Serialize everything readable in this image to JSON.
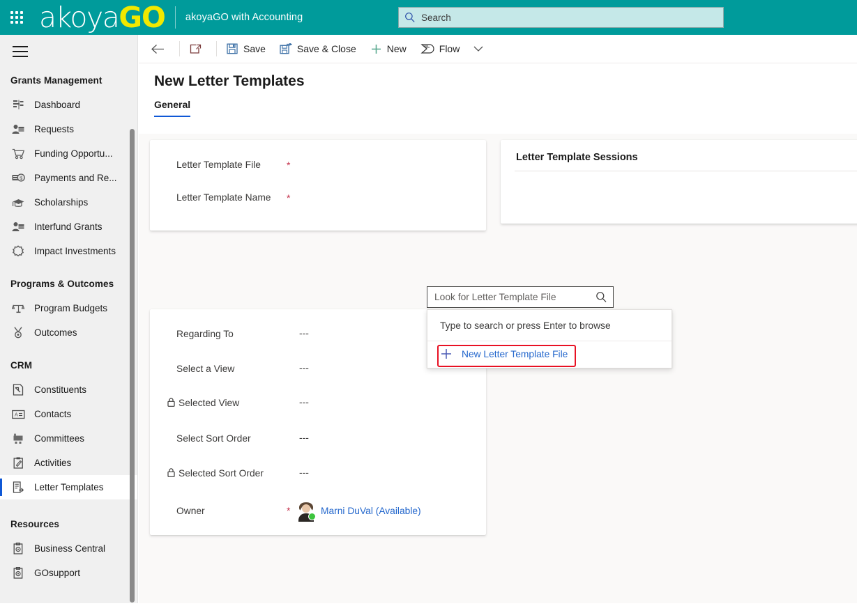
{
  "header": {
    "waffle_icon": "app-launcher-icon",
    "brand_primary": "akoya",
    "brand_accent": "GO",
    "app_title": "akoyaGO with Accounting",
    "search_placeholder": "Search",
    "search_icon": "search-icon",
    "background_color": "#009b9b",
    "accent_color": "#f2e800"
  },
  "sidebar": {
    "menu_icon": "hamburger-icon",
    "groups": [
      {
        "title": "Grants Management",
        "items": [
          {
            "label": "Dashboard",
            "icon": "dashboard-icon",
            "selected": false
          },
          {
            "label": "Requests",
            "icon": "requests-person-icon",
            "selected": false
          },
          {
            "label": "Funding Opportu...",
            "icon": "shopping-cart-icon",
            "selected": false
          },
          {
            "label": "Payments and Re...",
            "icon": "money-icon",
            "selected": false
          },
          {
            "label": "Scholarships",
            "icon": "graduation-cap-icon",
            "selected": false
          },
          {
            "label": "Interfund Grants",
            "icon": "interfund-person-icon",
            "selected": false
          },
          {
            "label": "Impact Investments",
            "icon": "gear-outline-icon",
            "selected": false
          }
        ]
      },
      {
        "title": "Programs & Outcomes",
        "items": [
          {
            "label": "Program Budgets",
            "icon": "scales-icon",
            "selected": false
          },
          {
            "label": "Outcomes",
            "icon": "medal-icon",
            "selected": false
          }
        ]
      },
      {
        "title": "CRM",
        "items": [
          {
            "label": "Constituents",
            "icon": "constituents-icon",
            "selected": false
          },
          {
            "label": "Contacts",
            "icon": "contact-card-icon",
            "selected": false
          },
          {
            "label": "Committees",
            "icon": "committees-icon",
            "selected": false
          },
          {
            "label": "Activities",
            "icon": "clipboard-pen-icon",
            "selected": false
          },
          {
            "label": "Letter Templates",
            "icon": "letter-template-icon",
            "selected": true
          }
        ]
      },
      {
        "title": "Resources",
        "items": [
          {
            "label": "Business Central",
            "icon": "clipboard-gear-icon",
            "selected": false
          },
          {
            "label": "GOsupport",
            "icon": "clipboard-gear-icon",
            "selected": false
          }
        ]
      }
    ]
  },
  "commandbar": {
    "back_icon": "back-arrow-icon",
    "popout_icon": "open-in-new-window-icon",
    "buttons": [
      {
        "label": "Save",
        "icon": "save-icon"
      },
      {
        "label": "Save & Close",
        "icon": "save-and-close-icon"
      },
      {
        "label": "New",
        "icon": "plus-icon"
      },
      {
        "label": "Flow",
        "icon": "flow-icon"
      }
    ],
    "overflow_icon": "chevron-down-icon"
  },
  "main": {
    "page_title": "New Letter Templates",
    "tabs": [
      {
        "label": "General",
        "active": true
      }
    ],
    "form_top": {
      "fields": [
        {
          "label": "Letter Template File",
          "required": true,
          "lookup_placeholder": "Look for Letter Template File",
          "lookup_icon": "search-icon"
        },
        {
          "label": "Letter Template Name",
          "required": true,
          "value": ""
        }
      ]
    },
    "lookup_flyout": {
      "hint": "Type to search or press Enter to browse",
      "new_record_label": "New Letter Template File",
      "new_record_icon": "plus-icon",
      "highlight_color": "#e81123"
    },
    "form_bottom": {
      "fields": [
        {
          "label": "Regarding To",
          "required": false,
          "locked": false,
          "value": "---"
        },
        {
          "label": "Select a View",
          "required": false,
          "locked": false,
          "value": "---"
        },
        {
          "label": "Selected View",
          "required": false,
          "locked": true,
          "value": "---"
        },
        {
          "label": "Select Sort Order",
          "required": false,
          "locked": false,
          "value": "---"
        },
        {
          "label": "Selected Sort Order",
          "required": false,
          "locked": true,
          "value": "---"
        }
      ],
      "owner": {
        "label": "Owner",
        "required": true,
        "name": "Marni DuVal (Available)",
        "presence": "available",
        "presence_color": "#3dc43d",
        "avatar_icon": "user-avatar"
      }
    },
    "right_panel": {
      "title": "Letter Template Sessions"
    }
  }
}
